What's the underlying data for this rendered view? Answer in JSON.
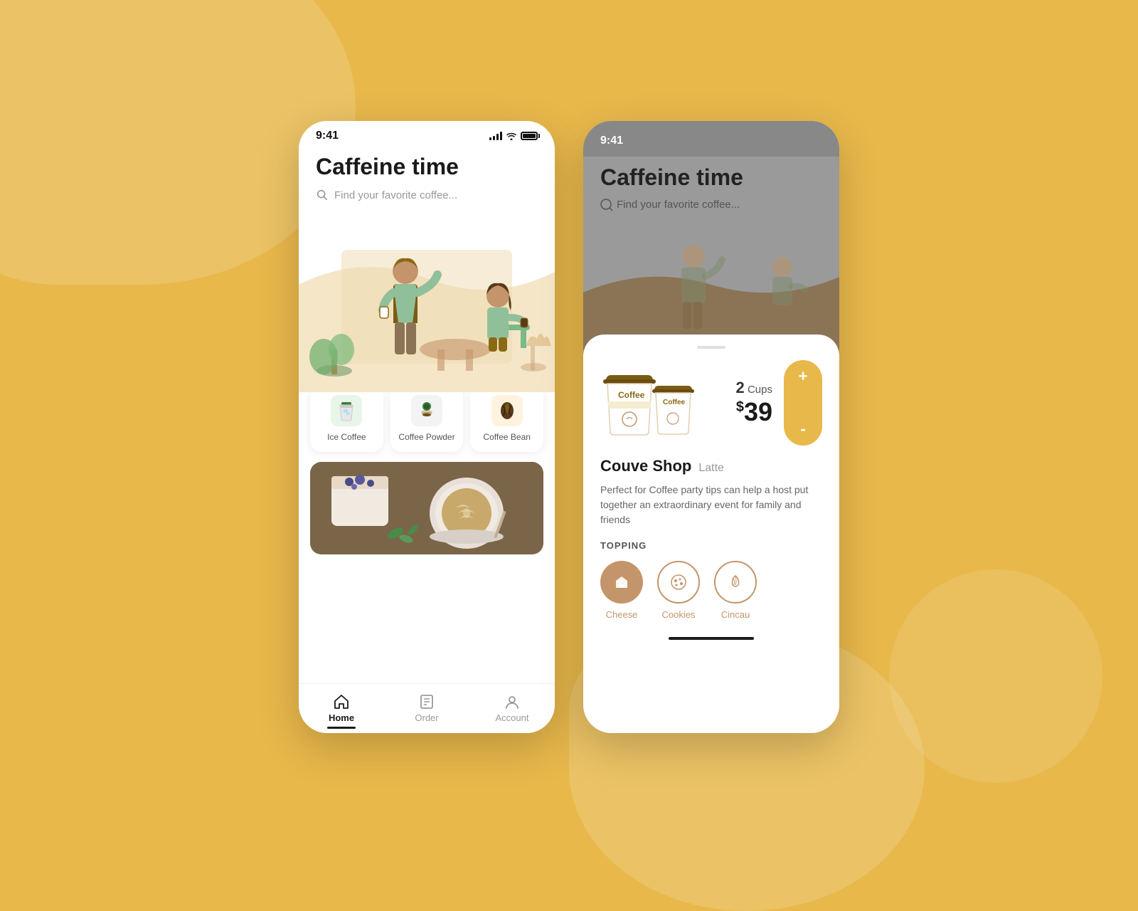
{
  "background": {
    "color": "#E8B84B"
  },
  "left_phone": {
    "status_bar": {
      "time": "9:41",
      "signal_strength": 4,
      "wifi": true,
      "battery": "full"
    },
    "header": {
      "title": "Caffeine time",
      "search_placeholder": "Find your favorite coffee..."
    },
    "categories": [
      {
        "id": "ice-coffee",
        "label": "Ice Coffee",
        "icon": "☕",
        "icon_type": "ice"
      },
      {
        "id": "coffee-powder",
        "label": "Coffee Powder",
        "icon": "🟢",
        "icon_type": "powder"
      },
      {
        "id": "coffee-bean",
        "label": "Coffee Bean",
        "icon": "🫘",
        "icon_type": "bean"
      }
    ],
    "nav": {
      "items": [
        {
          "id": "home",
          "label": "Home",
          "active": true
        },
        {
          "id": "order",
          "label": "Order",
          "active": false
        },
        {
          "id": "account",
          "label": "Account",
          "active": false
        }
      ]
    }
  },
  "right_phone": {
    "status_bar": {
      "time": "9:41",
      "signal_strength": 4,
      "wifi": true,
      "battery": "full"
    },
    "header": {
      "title": "Caffeine time",
      "search_placeholder": "Find your favorite coffee..."
    },
    "product": {
      "quantity": 2,
      "quantity_label": "Cups",
      "price": 39,
      "currency": "$",
      "shop": "Couve Shop",
      "type": "Latte",
      "description": "Perfect for Coffee party tips can help a host put together an extraordinary event for family and friends"
    },
    "toppings": {
      "title": "TOPPING",
      "items": [
        {
          "id": "cheese",
          "label": "Cheese",
          "icon": "🏠",
          "active": true
        },
        {
          "id": "cookies",
          "label": "Cookies",
          "icon": "🍪",
          "active": false
        },
        {
          "id": "cincau",
          "label": "Cincau",
          "icon": "🌿",
          "active": false
        }
      ]
    },
    "stepper": {
      "plus_label": "+",
      "minus_label": "-"
    }
  }
}
